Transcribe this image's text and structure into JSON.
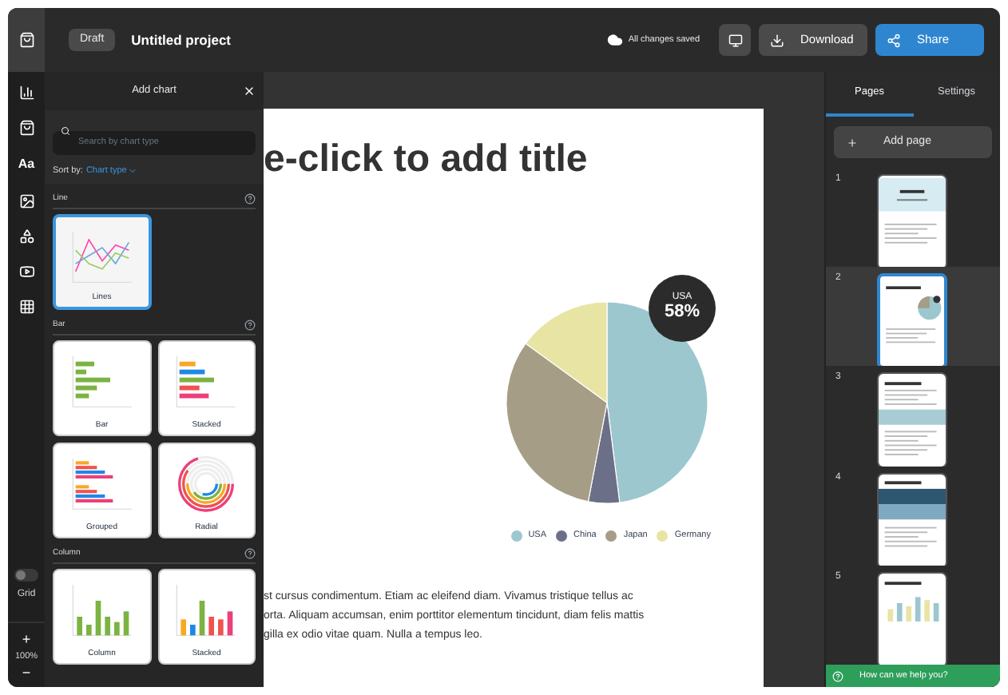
{
  "topbar": {
    "status": "Draft",
    "project": "Untitled project",
    "save_status": "All changes saved",
    "buttons": [
      {
        "label": "Download",
        "kind": "secondary"
      },
      {
        "label": "Share",
        "kind": "primary"
      }
    ]
  },
  "rail": {
    "text_tool": "Aa",
    "grid": {
      "label": "Grid",
      "on": false
    },
    "zoom": {
      "zoom_in": "+",
      "value": "100%",
      "zoom_out": "−"
    }
  },
  "panel": {
    "title": "Add chart",
    "search": {
      "placeholder": "Search by chart type"
    },
    "sort_label": "Sort by:",
    "sort_value": "Chart type",
    "sections": [
      {
        "title": "Line",
        "charts": [
          {
            "label": "Lines",
            "kind": "line",
            "selected": true
          }
        ]
      },
      {
        "title": "Bar",
        "charts": [
          {
            "label": "Bar",
            "kind": "bar",
            "selected": false
          },
          {
            "label": "Stacked",
            "kind": "stacked_bar",
            "selected": false
          },
          {
            "label": "Grouped",
            "kind": "grouped_bar",
            "selected": false
          },
          {
            "label": "Radial",
            "kind": "radial",
            "selected": false
          }
        ]
      },
      {
        "title": "Column",
        "charts": [
          {
            "label": "Column",
            "kind": "column",
            "selected": false
          },
          {
            "label": "Stacked",
            "kind": "stacked_column",
            "selected": false
          }
        ]
      }
    ]
  },
  "document": {
    "title": "e-click to add title",
    "badge": {
      "label": "USA",
      "value": "58%"
    },
    "legend": [
      {
        "label": "USA",
        "color": "#9cc7cf"
      },
      {
        "label": "China",
        "color": "#6b7088"
      },
      {
        "label": "Japan",
        "color": "#a59d85"
      },
      {
        "label": "Germany",
        "color": "#e8e4a4"
      }
    ],
    "paragraph_lines": [
      "st cursus condimentum. Etiam ac eleifend diam. Vivamus tristique tellus ac",
      "orta. Aliquam accumsan, enim porttitor elementum tincidunt, diam felis mattis",
      "gilla ex odio vitae quam. Nulla a tempus leo."
    ]
  },
  "sidebar": {
    "tabs": [
      {
        "label": "Pages",
        "selected": true
      },
      {
        "label": "Settings",
        "selected": false
      }
    ],
    "add_page": "Add page",
    "pages": [
      {
        "number": "1",
        "kind": "cover",
        "selected": false
      },
      {
        "number": "2",
        "kind": "pie",
        "selected": true
      },
      {
        "number": "3",
        "kind": "stats",
        "selected": false
      },
      {
        "number": "4",
        "kind": "photo",
        "selected": false
      },
      {
        "number": "5",
        "kind": "columns",
        "selected": false
      }
    ],
    "help": "How can we help you?"
  }
}
